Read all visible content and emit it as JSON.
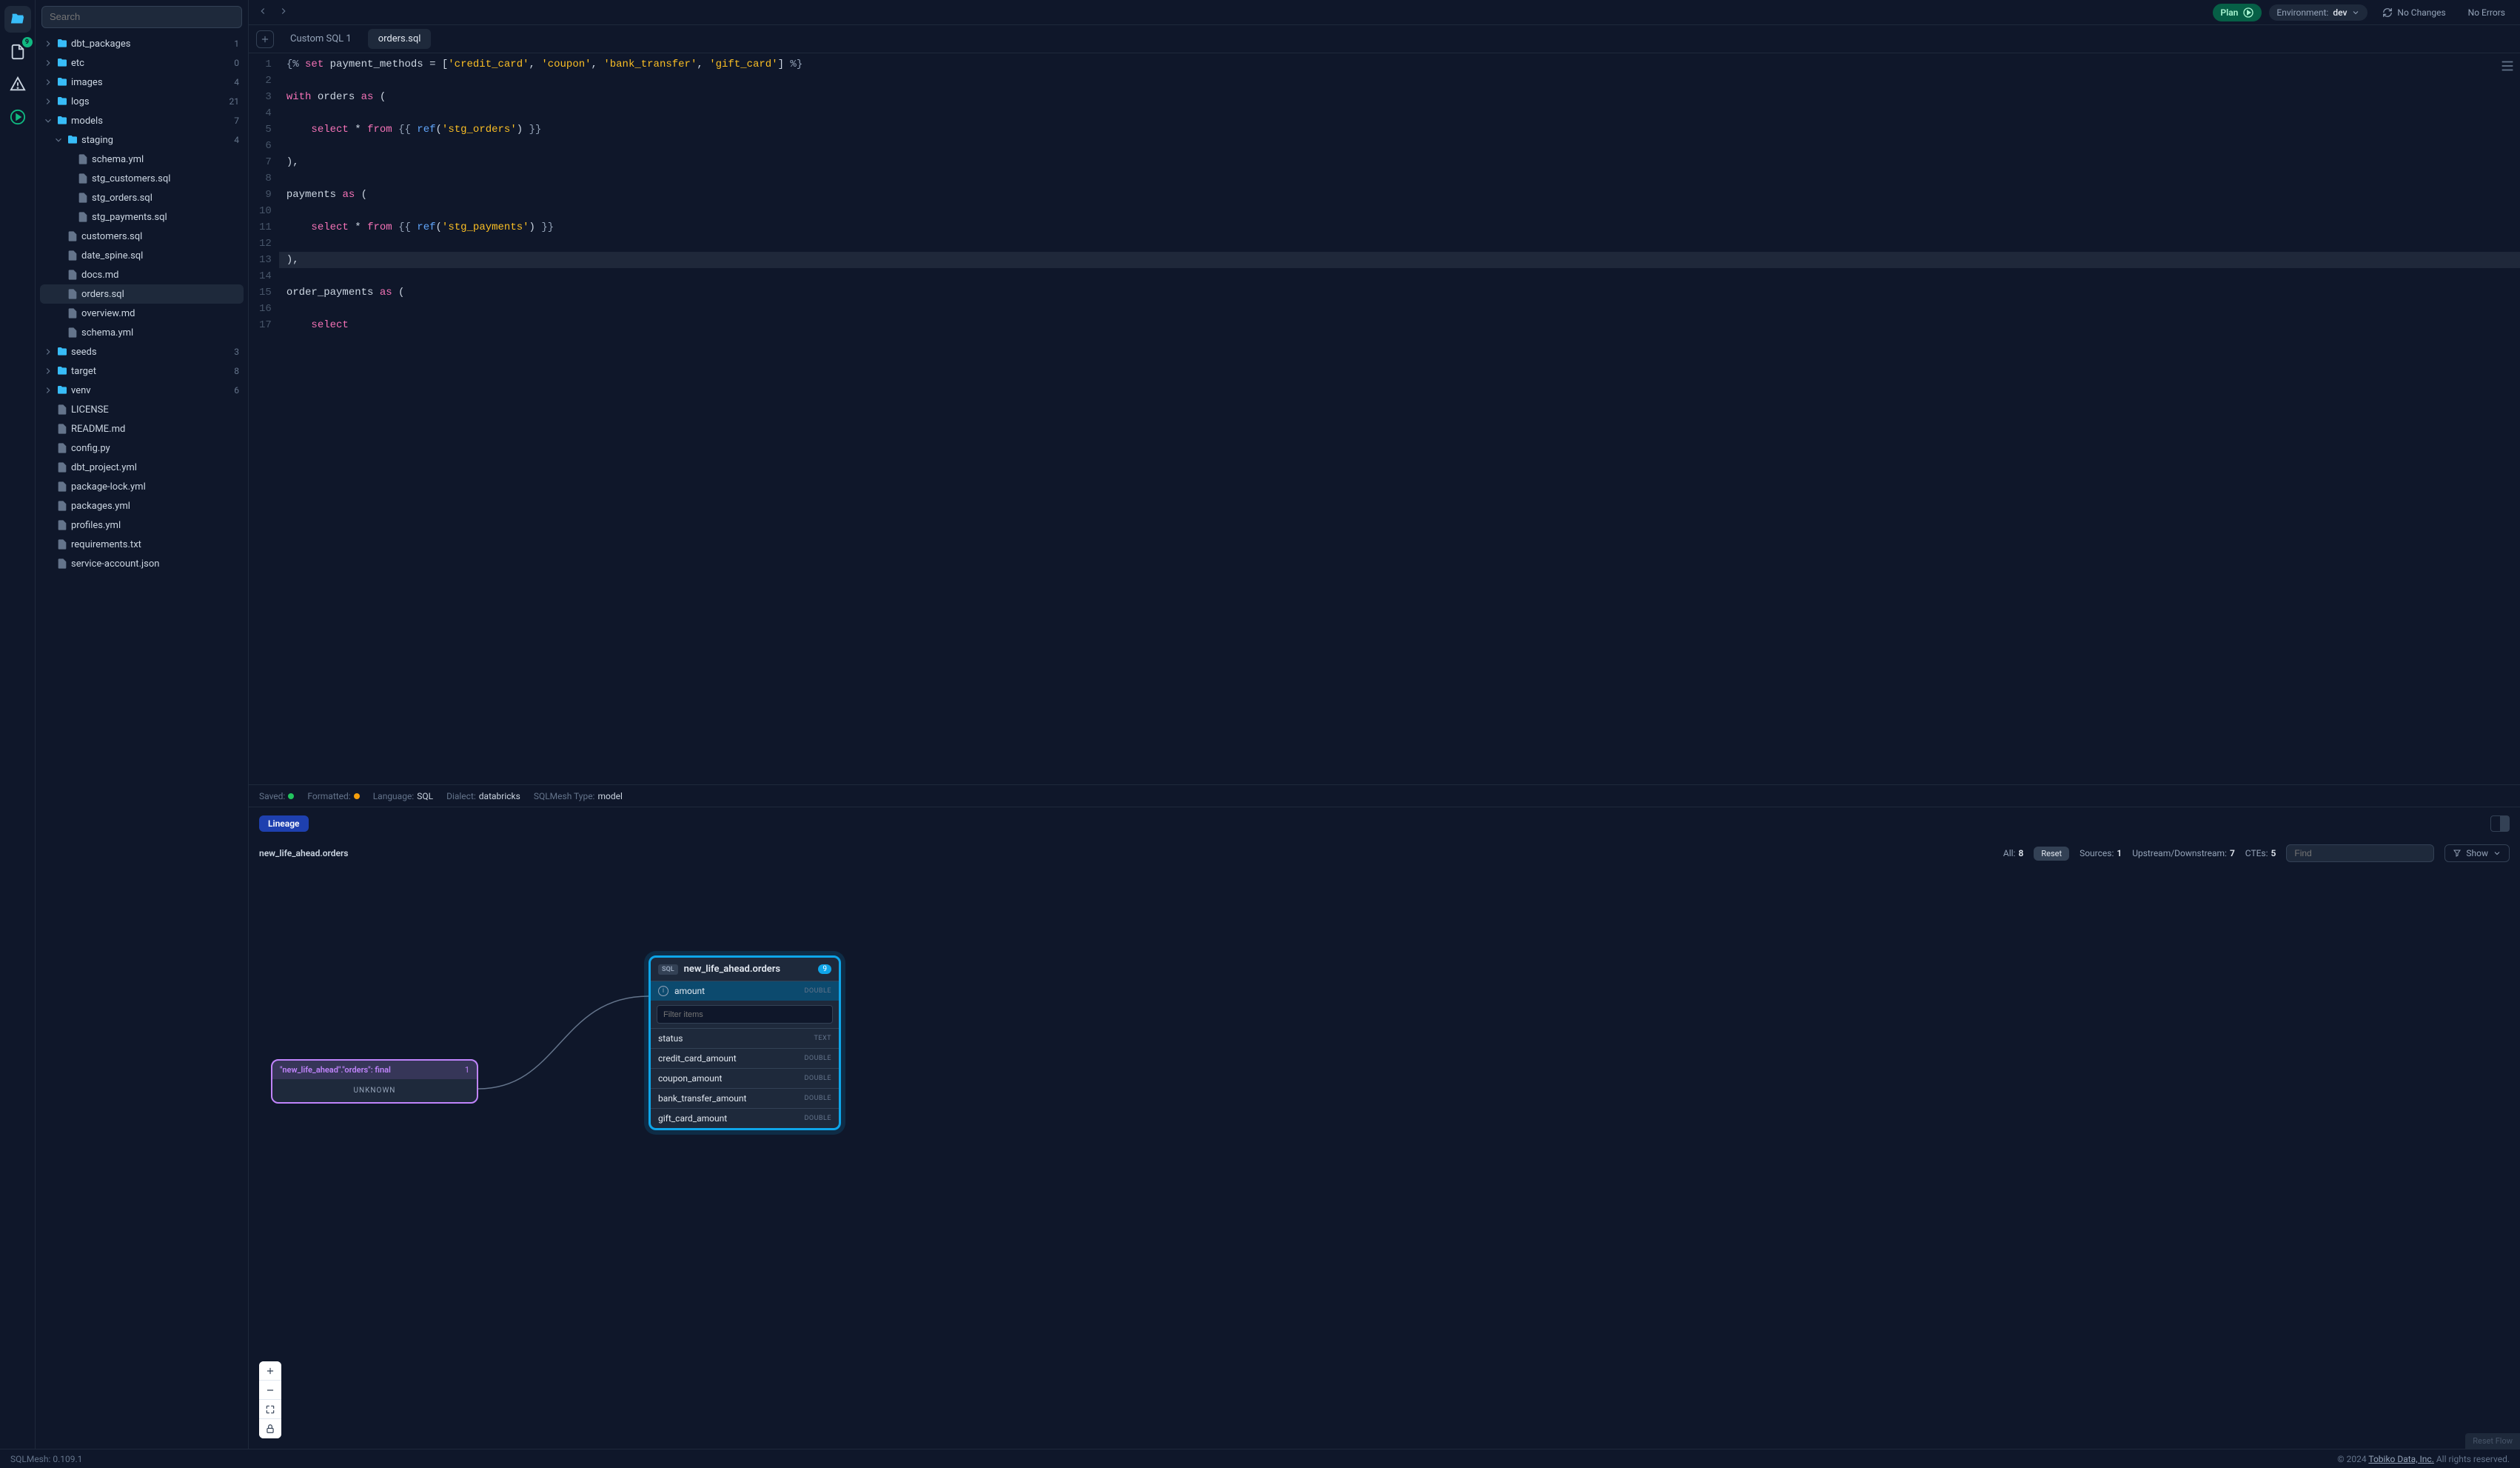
{
  "topbar": {
    "plan": "Plan",
    "env_label": "Environment:",
    "env_value": "dev",
    "no_changes": "No Changes",
    "no_errors": "No Errors"
  },
  "activity": {
    "doc_badge": "9"
  },
  "search_placeholder": "Search",
  "tree": [
    {
      "type": "folder",
      "label": "dbt_packages",
      "count": "1",
      "depth": 0,
      "open": false
    },
    {
      "type": "folder",
      "label": "etc",
      "count": "0",
      "depth": 0,
      "open": false
    },
    {
      "type": "folder",
      "label": "images",
      "count": "4",
      "depth": 0,
      "open": false
    },
    {
      "type": "folder",
      "label": "logs",
      "count": "21",
      "depth": 0,
      "open": false
    },
    {
      "type": "folder",
      "label": "models",
      "count": "7",
      "depth": 0,
      "open": true
    },
    {
      "type": "folder",
      "label": "staging",
      "count": "4",
      "depth": 1,
      "open": true
    },
    {
      "type": "file",
      "label": "schema.yml",
      "depth": 2
    },
    {
      "type": "file",
      "label": "stg_customers.sql",
      "depth": 2
    },
    {
      "type": "file",
      "label": "stg_orders.sql",
      "depth": 2
    },
    {
      "type": "file",
      "label": "stg_payments.sql",
      "depth": 2
    },
    {
      "type": "file",
      "label": "customers.sql",
      "depth": 1
    },
    {
      "type": "file",
      "label": "date_spine.sql",
      "depth": 1
    },
    {
      "type": "file",
      "label": "docs.md",
      "depth": 1
    },
    {
      "type": "file",
      "label": "orders.sql",
      "depth": 1,
      "selected": true
    },
    {
      "type": "file",
      "label": "overview.md",
      "depth": 1
    },
    {
      "type": "file",
      "label": "schema.yml",
      "depth": 1
    },
    {
      "type": "folder",
      "label": "seeds",
      "count": "3",
      "depth": 0,
      "open": false
    },
    {
      "type": "folder",
      "label": "target",
      "count": "8",
      "depth": 0,
      "open": false
    },
    {
      "type": "folder",
      "label": "venv",
      "count": "6",
      "depth": 0,
      "open": false
    },
    {
      "type": "file",
      "label": "LICENSE",
      "depth": 0
    },
    {
      "type": "file",
      "label": "README.md",
      "depth": 0
    },
    {
      "type": "file",
      "label": "config.py",
      "depth": 0
    },
    {
      "type": "file",
      "label": "dbt_project.yml",
      "depth": 0
    },
    {
      "type": "file",
      "label": "package-lock.yml",
      "depth": 0
    },
    {
      "type": "file",
      "label": "packages.yml",
      "depth": 0
    },
    {
      "type": "file",
      "label": "profiles.yml",
      "depth": 0
    },
    {
      "type": "file",
      "label": "requirements.txt",
      "depth": 0
    },
    {
      "type": "file",
      "label": "service-account.json",
      "depth": 0
    }
  ],
  "tabs": {
    "custom": "Custom SQL 1",
    "orders": "orders.sql"
  },
  "code": {
    "lines": [
      "{% set payment_methods = ['credit_card', 'coupon', 'bank_transfer', 'gift_card'] %}",
      "",
      "with orders as (",
      "",
      "    select * from {{ ref('stg_orders') }}",
      "",
      "),",
      "",
      "payments as (",
      "",
      "    select * from {{ ref('stg_payments') }}",
      "",
      "),",
      "",
      "order_payments as (",
      "",
      "    select"
    ],
    "highlight_line": 13
  },
  "editor_status": {
    "saved": "Saved:",
    "formatted": "Formatted:",
    "language_label": "Language:",
    "language": "SQL",
    "dialect_label": "Dialect:",
    "dialect": "databricks",
    "type_label": "SQLMesh Type:",
    "type": "model"
  },
  "lineage": {
    "tab": "Lineage",
    "breadcrumb": "new_life_ahead.orders",
    "stats": {
      "all_label": "All:",
      "all": "8",
      "reset": "Reset",
      "sources_label": "Sources:",
      "sources": "1",
      "updown_label": "Upstream/Downstream:",
      "updown": "7",
      "ctes_label": "CTEs:",
      "ctes": "5"
    },
    "find_placeholder": "Find",
    "show": "Show",
    "reset_flow": "Reset Flow",
    "upstream": {
      "title": "\"new_life_ahead\".\"orders\": final",
      "count": "1",
      "unknown": "UNKNOWN"
    },
    "main_node": {
      "badge": "SQL",
      "title": "new_life_ahead.orders",
      "count": "9",
      "active_col": "amount",
      "active_type": "DOUBLE",
      "filter_placeholder": "Filter items",
      "cols": [
        {
          "name": "status",
          "type": "TEXT"
        },
        {
          "name": "credit_card_amount",
          "type": "DOUBLE"
        },
        {
          "name": "coupon_amount",
          "type": "DOUBLE"
        },
        {
          "name": "bank_transfer_amount",
          "type": "DOUBLE"
        },
        {
          "name": "gift_card_amount",
          "type": "DOUBLE"
        }
      ]
    }
  },
  "footer": {
    "version": "SQLMesh: 0.109.1",
    "copyright": "© 2024 ",
    "company": "Tobiko Data, Inc.",
    "rights": " All rights reserved."
  }
}
